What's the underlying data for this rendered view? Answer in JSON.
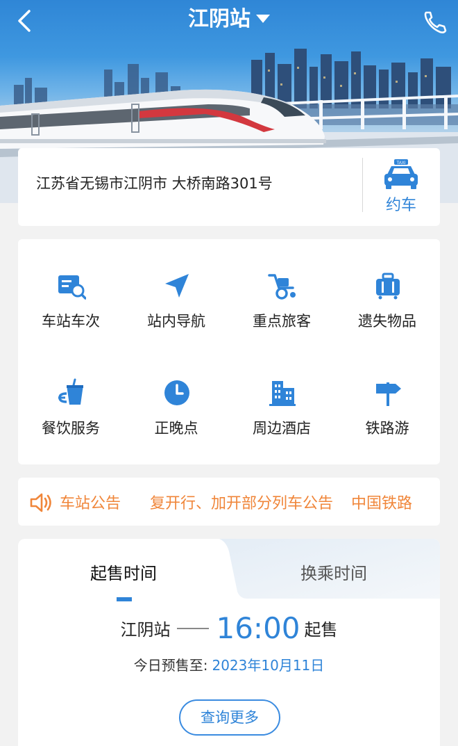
{
  "header": {
    "title": "江阴站"
  },
  "address": {
    "text": "江苏省无锡市江阴市 大桥南路301号",
    "taxi_label": "约车",
    "taxi_sign": "TAXI"
  },
  "services": [
    {
      "label": "车站车次",
      "icon": "station-train-search-icon"
    },
    {
      "label": "站内导航",
      "icon": "navigation-arrow-icon"
    },
    {
      "label": "重点旅客",
      "icon": "wheelchair-icon"
    },
    {
      "label": "遗失物品",
      "icon": "luggage-icon"
    },
    {
      "label": "餐饮服务",
      "icon": "drink-cup-icon"
    },
    {
      "label": "正晚点",
      "icon": "clock-icon"
    },
    {
      "label": "周边酒店",
      "icon": "hotel-building-icon"
    },
    {
      "label": "铁路游",
      "icon": "signpost-icon"
    }
  ],
  "notice": {
    "title": "车站公告",
    "items": [
      "复开行、加开部分列车公告",
      "中国铁路"
    ]
  },
  "sale": {
    "tabs": [
      "起售时间",
      "换乘时间"
    ],
    "active_tab": 0,
    "station": "江阴站",
    "time": "16:00",
    "time_suffix": "起售",
    "presale_label": "今日预售至:",
    "presale_date": "2023年10月11日",
    "more_button": "查询更多"
  },
  "colors": {
    "accent_blue": "#2f84d8",
    "notice_orange": "#f0863a"
  }
}
